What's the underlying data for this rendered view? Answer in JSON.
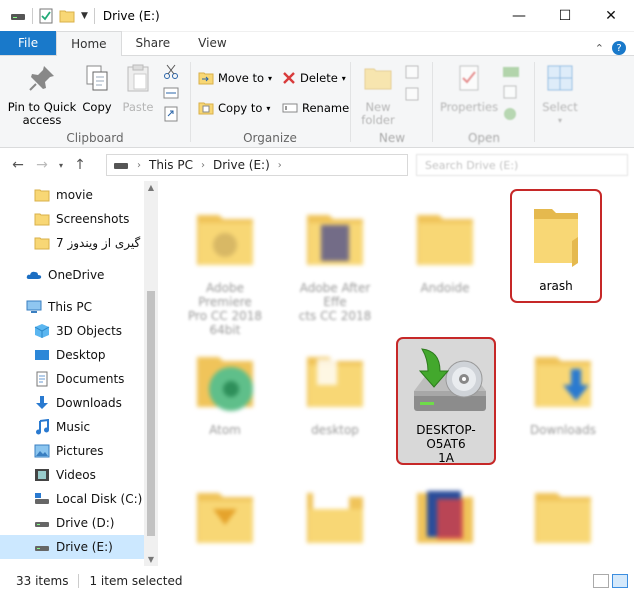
{
  "window": {
    "title": "Drive (E:)",
    "controls": {
      "minimize": "—",
      "maximize": "☐",
      "close": "✕"
    }
  },
  "ribbon_tabs": [
    "File",
    "Home",
    "Share",
    "View"
  ],
  "ribbon": {
    "clipboard": {
      "label": "Clipboard",
      "pin_line1": "Pin to Quick",
      "pin_line2": "access",
      "copy": "Copy",
      "paste": "Paste"
    },
    "organize": {
      "label": "Organize",
      "move_to": "Move to",
      "copy_to": "Copy to",
      "delete": "Delete",
      "rename": "Rename"
    },
    "new": {
      "label": "New",
      "new_line1": "New",
      "new_line2": "folder"
    },
    "open": {
      "label": "Open",
      "properties": "Properties"
    },
    "select": {
      "label": "",
      "select": "Select"
    }
  },
  "address": {
    "segments": [
      "This PC",
      "Drive (E:)"
    ],
    "search_placeholder": "Search Drive (E:)"
  },
  "nav_pane": [
    {
      "label": "movie",
      "icon": "folder-icon",
      "type": "child"
    },
    {
      "label": "Screenshots",
      "icon": "folder-icon",
      "type": "child"
    },
    {
      "label": "گیری از ویندوز 7",
      "icon": "folder-icon",
      "type": "child"
    },
    {
      "label": "OneDrive",
      "icon": "cloud-icon",
      "type": "root"
    },
    {
      "label": "This PC",
      "icon": "computer-icon",
      "type": "root"
    },
    {
      "label": "3D Objects",
      "icon": "cube-icon",
      "type": "child"
    },
    {
      "label": "Desktop",
      "icon": "desktop-icon",
      "type": "child"
    },
    {
      "label": "Documents",
      "icon": "document-icon",
      "type": "child"
    },
    {
      "label": "Downloads",
      "icon": "download-icon",
      "type": "child"
    },
    {
      "label": "Music",
      "icon": "music-icon",
      "type": "child"
    },
    {
      "label": "Pictures",
      "icon": "picture-icon",
      "type": "child"
    },
    {
      "label": "Videos",
      "icon": "video-icon",
      "type": "child"
    },
    {
      "label": "Local Disk (C:)",
      "icon": "drive-icon",
      "type": "child"
    },
    {
      "label": "Drive (D:)",
      "icon": "drive-icon",
      "type": "child"
    },
    {
      "label": "Drive (E:)",
      "icon": "drive-icon",
      "type": "child",
      "selected": true
    }
  ],
  "files": [
    {
      "line1": "Adobe Premiere",
      "line2": "Pro CC 2018",
      "line3": "64bit",
      "icon": "folder-icon"
    },
    {
      "line1": "Adobe After Effe",
      "line2": "cts CC 2018",
      "line3": "",
      "icon": "folder-icon"
    },
    {
      "line1": "Andoide",
      "line2": "",
      "line3": "",
      "icon": "folder-icon"
    },
    {
      "line1": "arash",
      "line2": "",
      "line3": "",
      "icon": "folder-icon",
      "highlighted": true
    },
    {
      "line1": "Atom",
      "line2": "",
      "line3": "",
      "icon": "atom-icon"
    },
    {
      "line1": "desktop",
      "line2": "",
      "line3": "",
      "icon": "folder-icon"
    },
    {
      "line1": "DESKTOP-O5AT6",
      "line2": "1A",
      "line3": "",
      "icon": "installer-drive-icon",
      "highlighted": true,
      "selected": true
    },
    {
      "line1": "Downloads",
      "line2": "",
      "line3": "",
      "icon": "folder-icon"
    },
    {
      "line1": "",
      "line2": "",
      "line3": "",
      "icon": "folder-icon"
    },
    {
      "line1": "",
      "line2": "",
      "line3": "",
      "icon": "folder-icon"
    },
    {
      "line1": "",
      "line2": "",
      "line3": "",
      "icon": "folder-icon"
    },
    {
      "line1": "",
      "line2": "",
      "line3": "",
      "icon": "folder-icon"
    }
  ],
  "status": {
    "items": "33 items",
    "selected": "1 item selected"
  },
  "colors": {
    "accent": "#1979ca",
    "folder": "#f8d775",
    "folder_dark": "#e5b94e",
    "highlight_border": "#c62828",
    "selection": "#cce8ff"
  }
}
